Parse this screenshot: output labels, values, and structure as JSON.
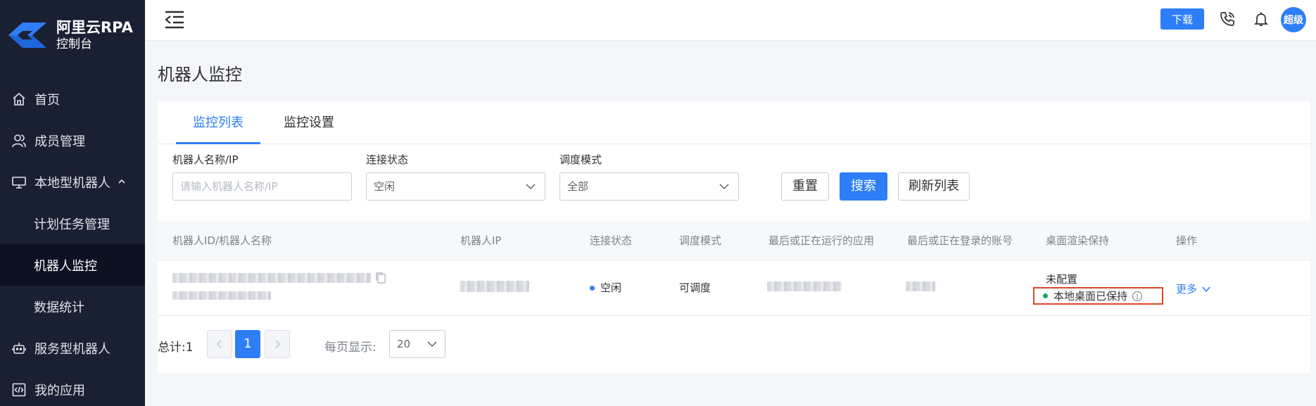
{
  "brand": {
    "title": "阿里云RPA",
    "subtitle": "控制台"
  },
  "sidebar": {
    "items": [
      {
        "label": "首页",
        "icon": "home-icon"
      },
      {
        "label": "成员管理",
        "icon": "users-icon"
      },
      {
        "label": "本地型机器人",
        "icon": "monitor-icon"
      },
      {
        "label": "计划任务管理"
      },
      {
        "label": "机器人监控"
      },
      {
        "label": "数据统计"
      },
      {
        "label": "服务型机器人",
        "icon": "robot-icon"
      },
      {
        "label": "我的应用",
        "icon": "code-icon"
      }
    ]
  },
  "header": {
    "download_label": "下载",
    "avatar_text": "超级"
  },
  "page": {
    "title": "机器人监控"
  },
  "tabs": [
    {
      "label": "监控列表"
    },
    {
      "label": "监控设置"
    }
  ],
  "filters": {
    "name_label": "机器人名称/IP",
    "name_placeholder": "请输入机器人名称/IP",
    "status_label": "连接状态",
    "status_value": "空闲",
    "mode_label": "调度模式",
    "mode_value": "全部",
    "reset_label": "重置",
    "search_label": "搜索",
    "refresh_label": "刷新列表"
  },
  "table": {
    "columns": [
      "机器人ID/机器人名称",
      "机器人IP",
      "连接状态",
      "调度模式",
      "最后或正在运行的应用",
      "最后或正在登录的账号",
      "桌面渲染保持",
      "操作"
    ],
    "rows": [
      {
        "status": "空闲",
        "mode": "可调度",
        "render_config": "未配置",
        "render_keep": "本地桌面已保持",
        "action": "更多"
      }
    ]
  },
  "pagination": {
    "total": "总计:1",
    "current_page": "1",
    "per_page_label": "每页显示:",
    "per_page_value": "20"
  },
  "colors": {
    "accent": "#2d7ef7",
    "sidebar_bg": "#1a2033",
    "status_idle": "#2d7ef7",
    "keep_ok": "#1fa85c",
    "highlight_border": "#e0452c"
  }
}
